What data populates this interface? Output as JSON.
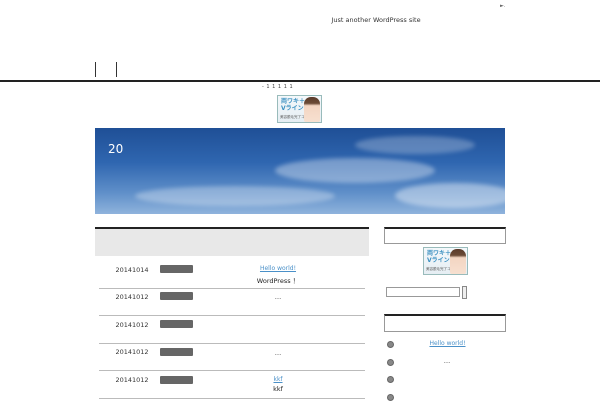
{
  "header": {
    "tagline": "Just another WordPress site",
    "top_right": "►."
  },
  "banner": {
    "label_above": "- 1 1 1 1 1",
    "ad_line1": "両ワキ＋",
    "ad_line2": "Vライン",
    "ad_line3": "美容脱毛完了コース"
  },
  "hero": {
    "title": "20"
  },
  "posts": [
    {
      "date": "20141014",
      "link": "Hello world!",
      "excerpt": "WordPress  ！"
    },
    {
      "date": "20141012",
      "link": "",
      "excerpt": "…"
    },
    {
      "date": "20141012",
      "link": "",
      "excerpt": ""
    },
    {
      "date": "20141012",
      "link": "",
      "excerpt": "…"
    },
    {
      "date": "20141012",
      "link": "kkf",
      "excerpt": "kkf"
    }
  ],
  "sidebar": {
    "recent_posts": [
      {
        "label": "Hello world!"
      },
      {
        "label": "…"
      },
      {
        "label": ""
      },
      {
        "label": ""
      }
    ]
  }
}
